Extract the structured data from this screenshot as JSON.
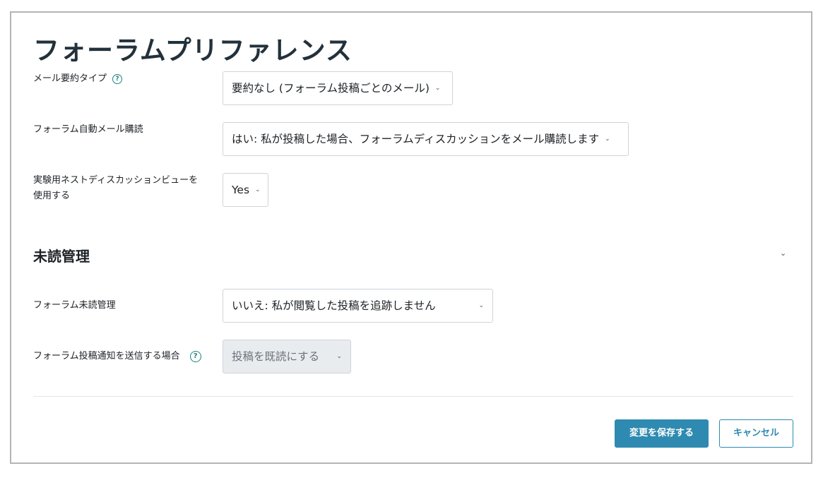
{
  "page": {
    "title": "フォーラムプリファレンス"
  },
  "fields": {
    "digest_type": {
      "label": "メール要約タイプ",
      "value": "要約なし (フォーラム投稿ごとのメール)"
    },
    "auto_subscribe": {
      "label": "フォーラム自動メール購読",
      "value": "はい: 私が投稿した場合、フォーラムディスカッションをメール購読します"
    },
    "nested_view": {
      "label_line1": "実験用ネストディスカッションビューを",
      "label_line2": "使用する",
      "value": "Yes"
    }
  },
  "section": {
    "title": "未読管理"
  },
  "tracking": {
    "track_unread": {
      "label": "フォーラム未読管理",
      "value": "いいえ: 私が閲覧した投稿を追跡しません"
    },
    "mark_read": {
      "label": "フォーラム投稿通知を送信する場合",
      "value": "投稿を既読にする"
    }
  },
  "actions": {
    "save_label": "変更を保存する",
    "cancel_label": "キャンセル"
  },
  "icons": {
    "help": "question-circle-icon",
    "caret": "chevron-down-icon"
  },
  "colors": {
    "primary": "#2e8ab0",
    "help": "#1f8282"
  }
}
